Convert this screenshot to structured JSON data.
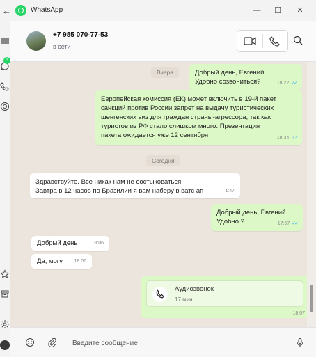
{
  "window": {
    "title": "WhatsApp",
    "back_glyph": "←",
    "minimize_glyph": "—",
    "maximize_glyph": "☐",
    "close_glyph": "✕"
  },
  "sidebar": {
    "unread_badge": "5",
    "icons": [
      "menu-icon",
      "chats-icon",
      "calls-icon",
      "status-icon",
      "starred-icon",
      "archive-icon",
      "settings-icon",
      "profile-avatar"
    ]
  },
  "header": {
    "contact_name": "+7 985 070-77-53",
    "status": "в сети",
    "icons": [
      "video-call-icon",
      "voice-call-icon",
      "search-icon"
    ]
  },
  "chat": {
    "date_yesterday": "Вчера",
    "date_today": "Сегодня",
    "messages": [
      {
        "direction": "out",
        "lines": [
          "Добрый день, Евгений",
          "Удобно созвониться?"
        ],
        "time": "18:22",
        "read": true
      },
      {
        "direction": "out",
        "lines": [
          "Европейская комиссия (ЕК) может включить в 19-й пакет",
          "санкций против России запрет на выдачу туристических",
          "шенгенских виз для граждан страны-агрессора, так как",
          "туристов из РФ стало слишком много. Презентация",
          "пакета ожидается уже 12 сентября"
        ],
        "time": "18:34",
        "read": true
      },
      {
        "direction": "in",
        "lines": [
          "Здравствуйте. Все никак нам не состыковаться.",
          "Завтра в 12 часов по Бразилии я вам наберу в ватс ап"
        ],
        "time": "1:47"
      },
      {
        "direction": "out",
        "lines": [
          "Добрый день, Евгений",
          "Удобно ?"
        ],
        "time": "17:57",
        "read": true
      },
      {
        "direction": "in",
        "lines": [
          "Добрый день"
        ],
        "time": "18:06"
      },
      {
        "direction": "in",
        "lines": [
          "Да, могу"
        ],
        "time": "18:06"
      }
    ],
    "call": {
      "title": "Аудиозвонок",
      "duration": "17 мин.",
      "time": "18:07"
    }
  },
  "composer": {
    "placeholder": "Введите сообщение",
    "icons": [
      "emoji-icon",
      "attach-icon",
      "microphone-icon"
    ]
  },
  "colors": {
    "outgoing_bubble": "#dcf8c6",
    "incoming_bubble": "#ffffff",
    "chat_background": "#ece5dd",
    "read_ticks": "#4fb6ec",
    "brand": "#25d366"
  }
}
